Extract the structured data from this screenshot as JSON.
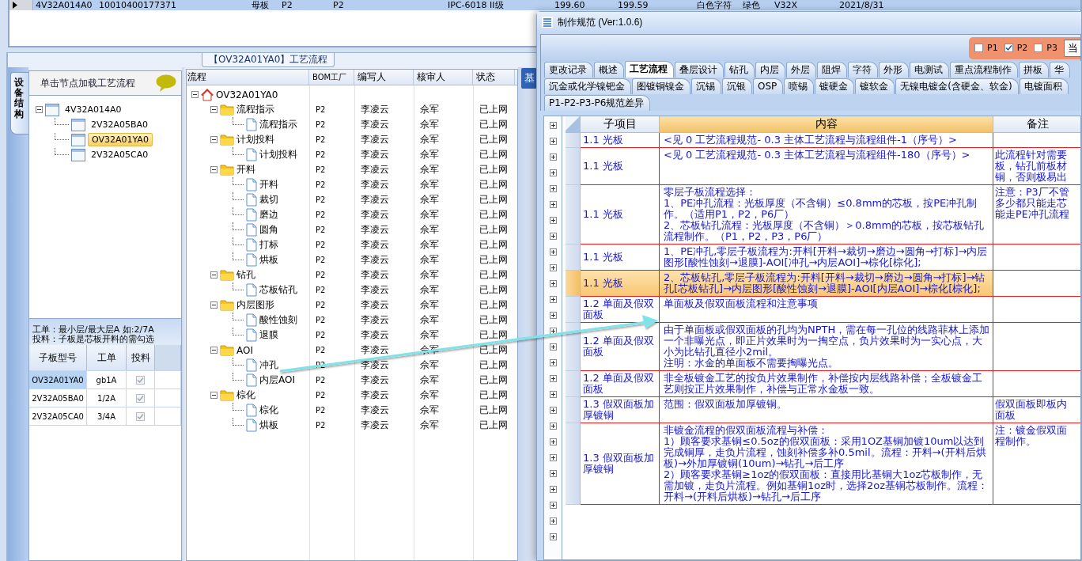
{
  "top_grid": {
    "rows": [
      {
        "selected": true,
        "cells": [
          "4V32A014A0",
          "10010400177371",
          "母板",
          "P2",
          "P2",
          "IPC-6018 II级",
          "199.60",
          "199.59",
          "白色字符",
          "绿色",
          "V32X",
          "2021/8/31"
        ]
      }
    ]
  },
  "process_pane": {
    "title": "【OV32A01YA0】工艺流程",
    "side_tab": "设备结构",
    "right_tab": "基",
    "board_panel": {
      "header": "单击节点加载工艺流程",
      "tree": [
        {
          "label": "4V32A014A0",
          "expanded": true,
          "selected": false,
          "children": [
            {
              "label": "2V32A05BA0",
              "selected": false
            },
            {
              "label": "OV32A01YA0",
              "selected": true
            },
            {
              "label": "2V32A05CA0",
              "selected": false
            }
          ]
        }
      ],
      "notes": [
        "工单：最小层/最大层A 如:2/7A",
        "投料：子板是芯板开料的需勾选"
      ],
      "table": {
        "columns": [
          "子板型号",
          "工单",
          "投料"
        ],
        "rows": [
          {
            "cells": [
              "OV32A01YA0",
              "gb1A"
            ],
            "checked": true,
            "selected": true
          },
          {
            "cells": [
              "2V32A05BA0",
              "1/2A"
            ],
            "checked": true,
            "selected": false
          },
          {
            "cells": [
              "2V32A05CA0",
              "3/4A"
            ],
            "checked": true,
            "selected": false
          }
        ]
      }
    },
    "flow_tree": {
      "columns": [
        "流程",
        "BOM工厂",
        "编写人",
        "核审人",
        "状态"
      ],
      "nodes": [
        {
          "kind": "root",
          "label": "OV32A01YA0",
          "expanded": true,
          "children": [
            {
              "kind": "folder",
              "label": "流程指示",
              "cells": [
                "P2",
                "李凌云",
                "佘军",
                "已上网"
              ],
              "expanded": true,
              "children": [
                {
                  "kind": "doc",
                  "label": "流程指示",
                  "cells": [
                    "P2",
                    "李凌云",
                    "佘军",
                    "已上网"
                  ]
                }
              ]
            },
            {
              "kind": "folder",
              "label": "计划投料",
              "cells": [
                "P2",
                "李凌云",
                "佘军",
                "已上网"
              ],
              "expanded": true,
              "children": [
                {
                  "kind": "doc",
                  "label": "计划投料",
                  "cells": [
                    "P2",
                    "李凌云",
                    "佘军",
                    "已上网"
                  ]
                }
              ]
            },
            {
              "kind": "folder",
              "label": "开料",
              "cells": [
                "P2",
                "李凌云",
                "佘军",
                "已上网"
              ],
              "expanded": true,
              "children": [
                {
                  "kind": "doc",
                  "label": "开料",
                  "cells": [
                    "P2",
                    "李凌云",
                    "佘军",
                    "已上网"
                  ]
                },
                {
                  "kind": "doc",
                  "label": "裁切",
                  "cells": [
                    "P2",
                    "李凌云",
                    "佘军",
                    "已上网"
                  ]
                },
                {
                  "kind": "doc",
                  "label": "磨边",
                  "cells": [
                    "P2",
                    "李凌云",
                    "佘军",
                    "已上网"
                  ]
                },
                {
                  "kind": "doc",
                  "label": "圆角",
                  "cells": [
                    "P2",
                    "李凌云",
                    "佘军",
                    "已上网"
                  ]
                },
                {
                  "kind": "doc",
                  "label": "打标",
                  "cells": [
                    "P2",
                    "李凌云",
                    "佘军",
                    "已上网"
                  ]
                },
                {
                  "kind": "doc",
                  "label": "烘板",
                  "cells": [
                    "P2",
                    "李凌云",
                    "佘军",
                    "已上网"
                  ]
                }
              ]
            },
            {
              "kind": "folder",
              "label": "钻孔",
              "cells": [
                "P2",
                "李凌云",
                "佘军",
                "已上网"
              ],
              "expanded": true,
              "children": [
                {
                  "kind": "doc",
                  "label": "芯板钻孔",
                  "cells": [
                    "P2",
                    "李凌云",
                    "佘军",
                    "已上网"
                  ]
                }
              ]
            },
            {
              "kind": "folder",
              "label": "内层图形",
              "cells": [
                "P2",
                "李凌云",
                "佘军",
                "已上网"
              ],
              "expanded": true,
              "children": [
                {
                  "kind": "doc",
                  "label": "酸性蚀刻",
                  "cells": [
                    "P2",
                    "李凌云",
                    "佘军",
                    "已上网"
                  ]
                },
                {
                  "kind": "doc",
                  "label": "退膜",
                  "cells": [
                    "P2",
                    "李凌云",
                    "佘军",
                    "已上网"
                  ]
                }
              ]
            },
            {
              "kind": "folder",
              "label": "AOI",
              "cells": [
                "P2",
                "李凌云",
                "佘军",
                "已上网"
              ],
              "expanded": true,
              "children": [
                {
                  "kind": "doc",
                  "label": "冲孔",
                  "cells": [
                    "P2",
                    "李凌云",
                    "佘军",
                    "已上网"
                  ]
                },
                {
                  "kind": "doc",
                  "label": "内层AOI",
                  "cells": [
                    "P2",
                    "李凌云",
                    "佘军",
                    "已上网"
                  ]
                }
              ]
            },
            {
              "kind": "folder",
              "label": "棕化",
              "cells": [
                "P2",
                "李凌云",
                "佘军",
                "已上网"
              ],
              "expanded": true,
              "children": [
                {
                  "kind": "doc",
                  "label": "棕化",
                  "cells": [
                    "P2",
                    "李凌云",
                    "佘军",
                    "已上网"
                  ]
                },
                {
                  "kind": "doc",
                  "label": "烘板",
                  "cells": [
                    "P2",
                    "李凌云",
                    "佘军",
                    "已上网"
                  ]
                }
              ]
            }
          ]
        }
      ]
    }
  },
  "spec_window": {
    "title": "制作规范 (Ver:1.0.6)",
    "plants": [
      {
        "label": "P1",
        "checked": false
      },
      {
        "label": "P2",
        "checked": true
      },
      {
        "label": "P3",
        "checked": false
      }
    ],
    "button": "当",
    "tab_rows": [
      [
        {
          "label": "更改记录",
          "selected": false
        },
        {
          "label": "概述",
          "selected": false
        },
        {
          "label": "工艺流程",
          "selected": true
        },
        {
          "label": "叠层设计",
          "selected": false
        },
        {
          "label": "钻孔",
          "selected": false
        },
        {
          "label": "内层",
          "selected": false
        },
        {
          "label": "外层",
          "selected": false
        },
        {
          "label": "阻焊",
          "selected": false
        },
        {
          "label": "字符",
          "selected": false
        },
        {
          "label": "外形",
          "selected": false
        },
        {
          "label": "电测试",
          "selected": false
        },
        {
          "label": "重点流程制作",
          "selected": false
        },
        {
          "label": "拼板",
          "selected": false
        },
        {
          "label": "华",
          "selected": false
        }
      ],
      [
        {
          "label": "沉金或化学镍钯金",
          "selected": false
        },
        {
          "label": "图镀铜镍金",
          "selected": false
        },
        {
          "label": "沉锡",
          "selected": false
        },
        {
          "label": "沉银",
          "selected": false
        },
        {
          "label": "OSP",
          "selected": false
        },
        {
          "label": "喷锡",
          "selected": false
        },
        {
          "label": "镀硬金",
          "selected": false
        },
        {
          "label": "镀软金",
          "selected": false
        },
        {
          "label": "无镍电镀金(含硬金、软金)",
          "selected": false
        },
        {
          "label": "电镀面积",
          "selected": false
        }
      ],
      [
        {
          "label": "P1-P2-P3-P6规范差异",
          "selected": false
        }
      ]
    ],
    "table": {
      "columns": [
        "子项目",
        "内容",
        "备注"
      ],
      "rows": [
        {
          "item": "1.1 光板",
          "content": "<见 0 工艺流程规范- 0.3 主体工艺流程与流程组件-1（序号）>",
          "selected": false
        },
        {
          "item": "1.1 光板",
          "content": "<见 0 工艺流程规范- 0.3 主体工艺流程与流程组件-180（序号）>",
          "remark": "此流程针对需要板，钻孔前板材铜，否则极易出",
          "selected": false
        },
        {
          "item": "1.1 光板",
          "content": [
            "零层子板流程选择：",
            "1、PE冲孔流程：光板厚度（不含铜）≤0.8mm的芯板，按PE冲孔制作。（适用P1，P2，P6厂）",
            "2、芯板钻孔流程：光板厚度（不含铜）＞0.8mm的芯板，按芯板钻孔流程制作。（P1，P2，P3，P6厂）"
          ],
          "remark": "注意：P3厂不管多少都只能走芯能走PE冲孔流程",
          "selected": false
        },
        {
          "item": "1.1 光板",
          "content": "1、PE冲孔,零层子板流程为:开料[开料→裁切→磨边→圆角→打标]→内层图形[酸性蚀刻→退膜]-AOI[冲孔→内层AOI]→棕化[棕化];",
          "selected": false
        },
        {
          "item": "1.1 光板",
          "content": "2、芯板钻孔,零层子板流程为:开料[开料→裁切→磨边→圆角→打标]→钻孔[芯板钻孔]→内层图形[酸性蚀刻→退膜]-AOI[内层AOI]→棕化[棕化];",
          "selected": true
        },
        {
          "item": "1.2 单面及假双面板",
          "content": "单面板及假双面板流程和注意事项",
          "selected": false
        },
        {
          "item": "1.2 单面及假双面板",
          "content": [
            "由于单面板或假双面板的孔均为NPTH，需在每一孔位的线路菲林上添加一个非曝光点，即正片效果时为一掏空点，负片效果时为一实心点，大小为比钻孔直径小2mil。",
            "注明：水金的单面板不需要掏曝光点。"
          ],
          "selected": false
        },
        {
          "item": "1.2 单面及假双面板",
          "content": "非全板镀金工艺的按负片效果制作，补偿按内层线路补偿；全板镀金工艺则按正片效果制作，补偿与正常水金板一致。",
          "selected": false
        },
        {
          "item": "1.3 假双面板加厚镀铜",
          "content": "范围：假双面板加厚镀铜。",
          "remark": "假双面板即板内面板",
          "selected": false
        },
        {
          "item": "1.3 假双面板加厚镀铜",
          "content": [
            "非镀金流程的假双面板流程与补偿：",
            "1）顾客要求基铜≤0.5oz的假双面板：采用1OZ基铜加镀10um以达到完成铜厚，走负片流程，蚀刻补偿多补0.5mil。流程：开料→(开料后烘板)→外加厚镀铜(10um)→钻孔→后工序",
            "2）顾客要求基铜≥1oz的假双面板：直接用比基铜大1oz芯板制作，无需加镀，走负片流程。例如基铜1oz时，选择2oz基铜芯板制作。流程：开料→(开料后烘板)→钻孔→后工序"
          ],
          "remark": "注：镀金假双面程制作。",
          "selected": false
        }
      ]
    }
  }
}
